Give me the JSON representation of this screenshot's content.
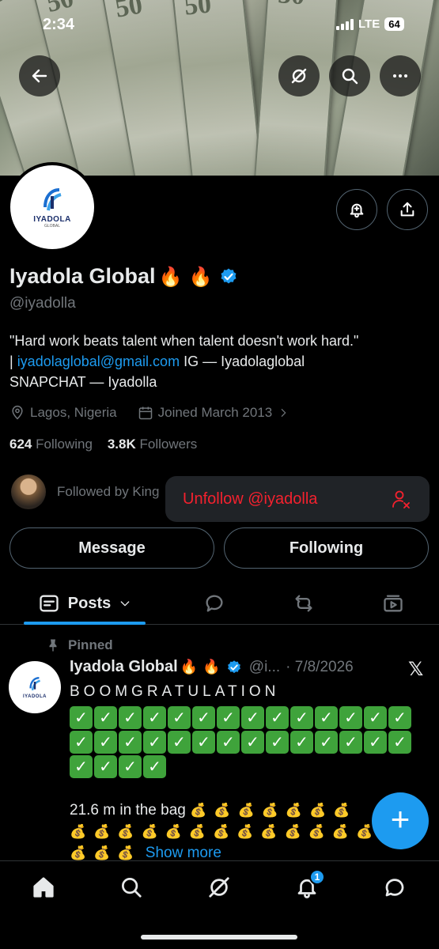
{
  "status_bar": {
    "time": "2:34",
    "network": "LTE",
    "battery": "64"
  },
  "banner": {
    "bill_labels": [
      "50",
      "50",
      "50",
      "50",
      "50"
    ]
  },
  "header_actions": {
    "back": "back-arrow-icon",
    "grok": "grok-icon",
    "search": "search-icon",
    "more": "more-icon"
  },
  "profile": {
    "avatar_logo_text": "IYADOLA",
    "avatar_logo_sub": "GLOBAL",
    "name": "Iyadola Global",
    "name_emoji": "🔥 🔥",
    "handle": "@iyadolla",
    "bio_line1": "\"Hard work beats talent when talent doesn't work hard.\"",
    "bio_sep": "| ",
    "bio_email": "iyadolaglobal@gmail.com",
    "bio_ig": " IG — Iyadolaglobal",
    "bio_line3": "SNAPCHAT — Iyadolla",
    "location": "Lagos, Nigeria",
    "joined": "Joined March 2013",
    "following_count": "624",
    "following_label": "Following",
    "followers_count": "3.8K",
    "followers_label": "Followers",
    "followed_by": "Followed by King"
  },
  "popup": {
    "unfollow_label": "Unfollow @iyadolla"
  },
  "buttons": {
    "message": "Message",
    "following": "Following"
  },
  "tabs": {
    "posts": "Posts"
  },
  "post": {
    "pinned_label": "Pinned",
    "author": "Iyadola Global",
    "author_emoji": "🔥 🔥",
    "handle_short": "@i...",
    "date": "· 7/8/2026",
    "headline": "BOOMGRATULATION",
    "check_count": 32,
    "bag_text": "21.6 m in the bag",
    "show_more": "Show more"
  },
  "fab": {
    "label": "+"
  },
  "nav": {
    "notifications_badge": "1"
  },
  "colors": {
    "accent": "#1d9bf0",
    "danger": "#f4212e",
    "muted": "#71767b",
    "text": "#e7e9ea",
    "background": "#000000"
  }
}
